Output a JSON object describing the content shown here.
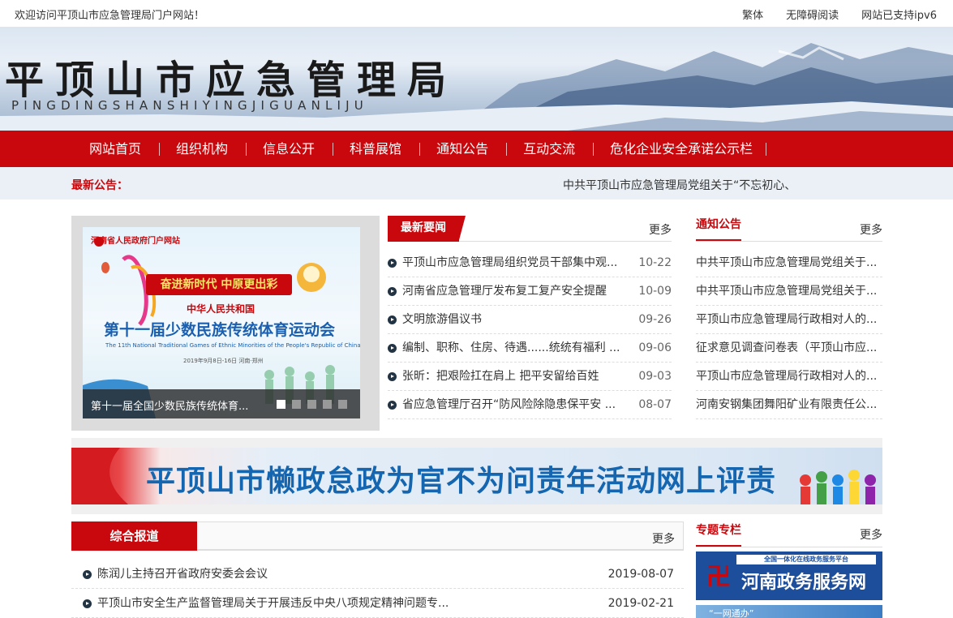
{
  "topbar": {
    "welcome": "欢迎访问平顶山市应急管理局门户网站！",
    "traditional": "繁体",
    "accessible": "无障碍阅读",
    "ipv6": "网站已支持ipv6"
  },
  "banner": {
    "title": "平顶山市应急管理局",
    "pinyin": "PINGDINGSHANSHIYINGJIGUANLIJU"
  },
  "nav": {
    "items": [
      "网站首页",
      "组织机构",
      "信息公开",
      "科普展馆",
      "通知公告",
      "互动交流",
      "危化企业安全承诺公示栏"
    ]
  },
  "notice_bar": {
    "label": "最新公告：",
    "text": "中共平顶山市应急管理局党组关于“不忘初心、"
  },
  "slider": {
    "image": {
      "gov": "河南省人民政府门户网站",
      "slogan": "奋进新时代 中原更出彩",
      "country": "中华人民共和国",
      "games": "第十一届少数民族传统体育运动会",
      "eng": "The 11th National Traditional Games of Ethnic Minorities of the People's Republic of China",
      "date": "2019年9月8日-16日 河南·郑州"
    },
    "caption": "第十一届全国少数民族传统体育...",
    "dots": 5,
    "active": 0
  },
  "news": {
    "title": "最新要闻",
    "more": "更多",
    "items": [
      {
        "title": "平顶山市应急管理局组织党员干部集中观...",
        "date": "10-22"
      },
      {
        "title": "河南省应急管理厅发布复工复产安全提醒",
        "date": "10-09"
      },
      {
        "title": "文明旅游倡议书",
        "date": "09-26"
      },
      {
        "title": "编制、职称、住房、待遇......统统有福利 ...",
        "date": "09-06"
      },
      {
        "title": "张昕：把艰险扛在肩上 把平安留给百姓",
        "date": "09-03"
      },
      {
        "title": "省应急管理厅召开“防风险除隐患保平安 ...",
        "date": "08-07"
      }
    ]
  },
  "notices": {
    "title": "通知公告",
    "more": "更多",
    "items": [
      "中共平顶山市应急管理局党组关于...",
      "中共平顶山市应急管理局党组关于...",
      "平顶山市应急管理局行政相对人的...",
      "征求意见调查问卷表（平顶山市应...",
      "平顶山市应急管理局行政相对人的...",
      "河南安钢集团舞阳矿业有限责任公..."
    ]
  },
  "campaign": {
    "text": "平顶山市懒政怠政为官不为问责年活动网上评责"
  },
  "reports": {
    "title": "综合报道",
    "more": "更多",
    "items": [
      {
        "title": "陈润儿主持召开省政府安委会会议",
        "date": "2019-08-07"
      },
      {
        "title": "平顶山市安全生产监督管理局关于开展违反中央八项规定精神问题专...",
        "date": "2019-02-21"
      }
    ]
  },
  "special": {
    "title": "专题专栏",
    "more": "更多",
    "service_top": "全国一体化在线政务服务平台",
    "service_name": "河南政务服务网",
    "service2": "“一网通办”"
  }
}
